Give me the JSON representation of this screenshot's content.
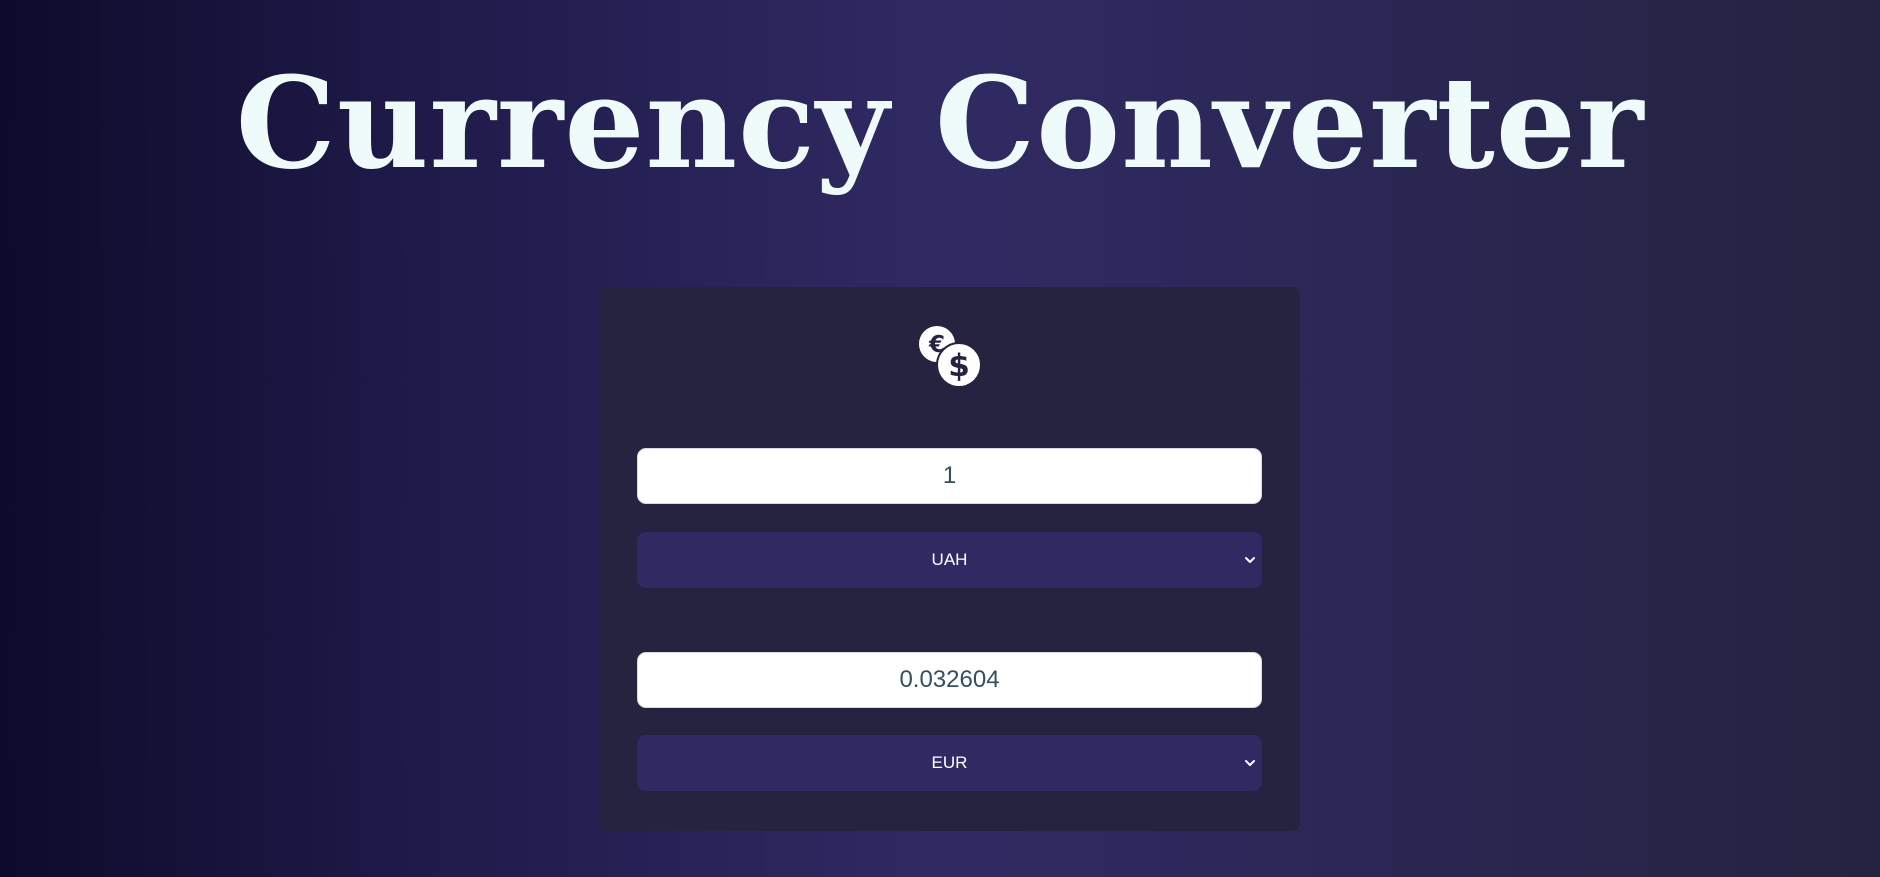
{
  "header": {
    "title": "Currency Converter"
  },
  "converter": {
    "icon": "currency-exchange-icon",
    "from": {
      "amount": "1",
      "currency": "UAH"
    },
    "to": {
      "amount": "0.032604",
      "currency": "EUR"
    }
  },
  "colors": {
    "background_dark": "#0d0b2b",
    "background_mid": "#302a63",
    "card": "#252340",
    "select": "#302a63",
    "title": "#effbfb",
    "input_text": "#33505c"
  }
}
